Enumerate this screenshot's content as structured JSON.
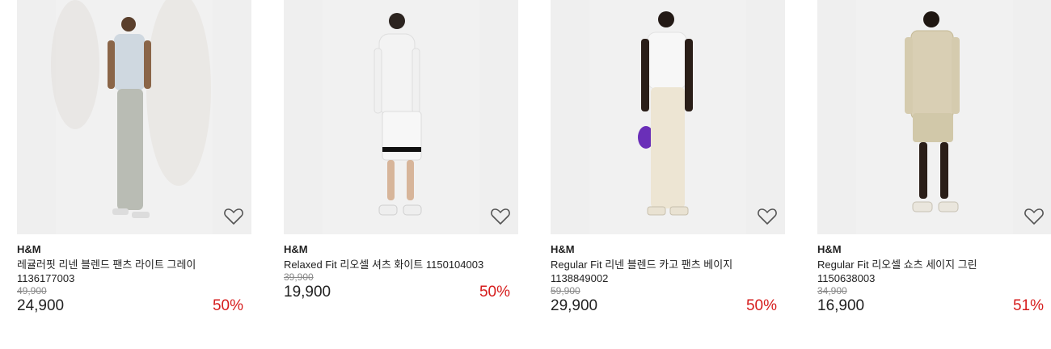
{
  "products": [
    {
      "brand": "H&M",
      "name": "레귤러핏 리넨 블렌드 팬츠 라이트 그레이",
      "code": "1136177003",
      "old_price": "49,900",
      "price": "24,900",
      "discount": "50%",
      "image_icon": "model-photo"
    },
    {
      "brand": "H&M",
      "name": "Relaxed Fit 리오셀 셔츠 화이트 1150104003",
      "code": "",
      "old_price": "39,900",
      "price": "19,900",
      "discount": "50%",
      "image_icon": "model-photo"
    },
    {
      "brand": "H&M",
      "name": "Regular Fit 리넨 블렌드 카고 팬츠 베이지",
      "code": "1138849002",
      "old_price": "59,900",
      "price": "29,900",
      "discount": "50%",
      "image_icon": "model-photo"
    },
    {
      "brand": "H&M",
      "name": "Regular Fit 리오셀 쇼츠 세이지 그린",
      "code": "1150638003",
      "old_price": "34,900",
      "price": "16,900",
      "discount": "51%",
      "image_icon": "model-photo"
    }
  ],
  "colors": {
    "discount": "#d61d1d",
    "old_price": "#888888",
    "text": "#222222",
    "image_bg": "#efefef"
  },
  "wishlist_icon": "heart-outline-icon"
}
